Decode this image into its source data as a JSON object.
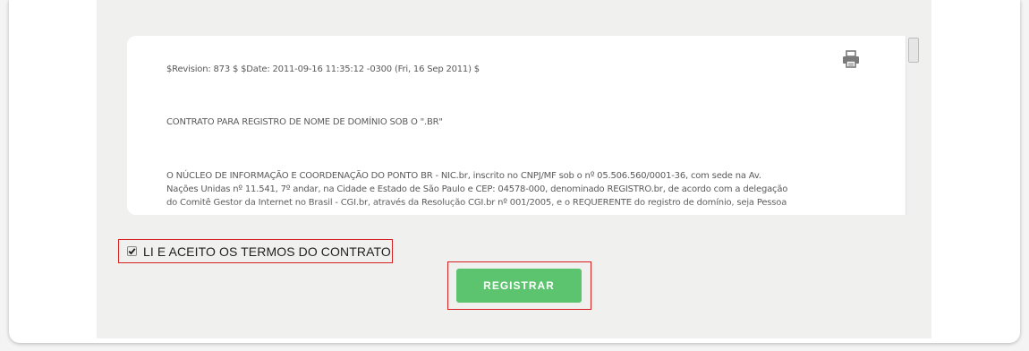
{
  "contract": {
    "revision_line": "$Revision: 873 $ $Date: 2011-09-16 11:35:12 -0300 (Fri, 16 Sep 2011) $",
    "title": "CONTRATO PARA REGISTRO DE NOME DE DOMÍNIO SOB O \".BR\"",
    "body_lines": [
      "O NÚCLEO DE INFORMAÇÃO E COORDENAÇÃO DO PONTO BR - NIC.br, inscrito no CNPJ/MF sob o nº 05.506.560/0001-36, com sede na Av.",
      "Nações Unidas nº 11.541, 7º andar, na Cidade e Estado de São Paulo e CEP: 04578-000, denominado REGISTRO.br, de acordo com a delegação",
      "do Comitê Gestor da Internet no Brasil - CGI.br, através da Resolução CGI.br nº 001/2005, e o REQUERENTE do registro de domínio, seja Pessoa"
    ],
    "print_icon": "printer-icon"
  },
  "agreement": {
    "label": "LI E ACEITO OS TERMOS DO CONTRATO",
    "checked": true
  },
  "actions": {
    "register_label": "REGISTRAR",
    "register_color": "#5cc46f"
  },
  "colors": {
    "highlight_border": "#d42020"
  }
}
